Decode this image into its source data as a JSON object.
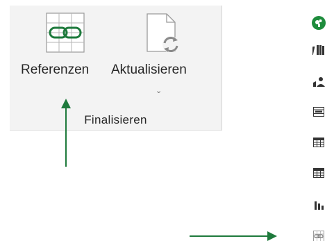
{
  "ribbon": {
    "group_label": "Finalisieren",
    "buttons": [
      {
        "label": "Referenzen",
        "icon": "link-table-icon"
      },
      {
        "label": "Aktualisieren",
        "icon": "refresh-document-icon",
        "has_dropdown": true
      }
    ],
    "dropdown_caret": "⌄"
  },
  "annotations": {
    "arrow_color": "#1e7a3c"
  },
  "sidebar": {
    "items": [
      {
        "icon": "green-circle-app-icon",
        "color": "#1e8c3c"
      },
      {
        "icon": "books-icon"
      },
      {
        "icon": "person-reading-icon"
      },
      {
        "icon": "table-form-icon"
      },
      {
        "icon": "table-icon"
      },
      {
        "icon": "table-list-icon"
      },
      {
        "icon": "bar-chart-icon"
      },
      {
        "icon": "link-table-icon"
      }
    ]
  }
}
